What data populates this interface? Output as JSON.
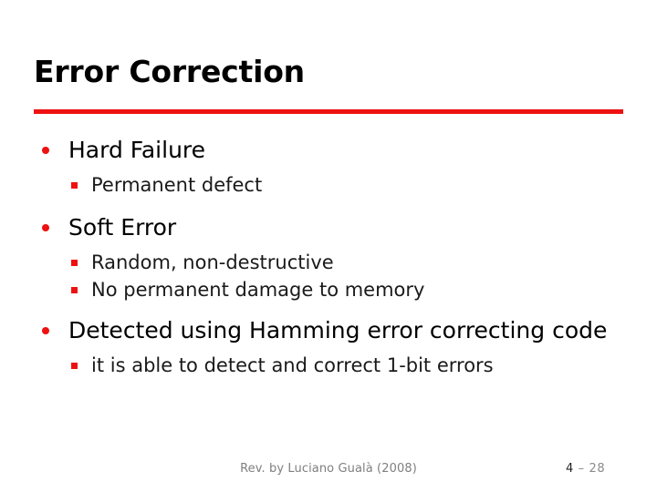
{
  "slide": {
    "title": "Error Correction",
    "accent_color": "#ee1111",
    "background_color": "#ffffff",
    "bullets": [
      {
        "level": 1,
        "text": "Hard Failure",
        "marker": "red-dot-bullet"
      },
      {
        "level": 2,
        "text": "Permanent defect",
        "marker": "red-square-bullet"
      },
      {
        "level": 1,
        "text": "Soft Error",
        "marker": "red-dot-bullet"
      },
      {
        "level": 2,
        "text": "Random, non-destructive",
        "marker": "red-square-bullet"
      },
      {
        "level": 2,
        "text": "No permanent damage to memory",
        "marker": "red-square-bullet"
      },
      {
        "level": 1,
        "text": "Detected using Hamming error correcting code",
        "marker": "red-dot-bullet"
      },
      {
        "level": 2,
        "text": "it is able to detect and correct 1-bit errors",
        "marker": "red-square-bullet"
      }
    ]
  },
  "footer": {
    "credit": "Rev. by Luciano Gualà (2008)",
    "current_page": "4",
    "page_separator": "–",
    "total_pages": "28"
  }
}
